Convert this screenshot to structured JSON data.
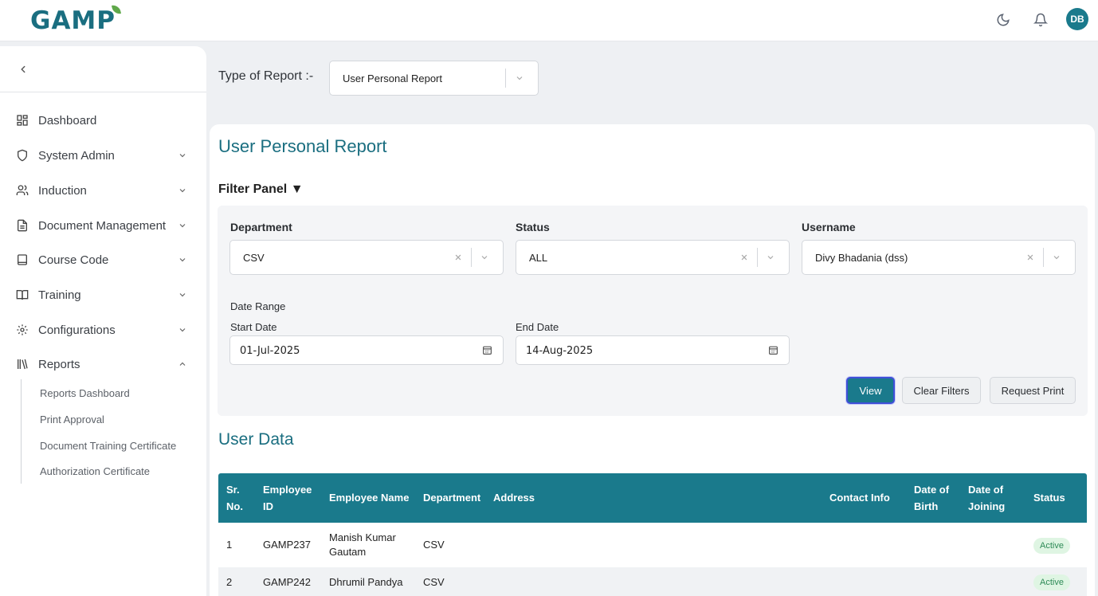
{
  "brand": {
    "logo_text": "GAMP"
  },
  "header": {
    "avatar_initials": "DB",
    "icons": [
      "moon-icon",
      "bell-icon"
    ]
  },
  "sidebar": {
    "items": [
      {
        "label": "Dashboard",
        "icon": "grid-icon",
        "chevron": ""
      },
      {
        "label": "System Admin",
        "icon": "shield-icon",
        "chevron": "down"
      },
      {
        "label": "Induction",
        "icon": "users-icon",
        "chevron": "down"
      },
      {
        "label": "Document Management",
        "icon": "file-icon",
        "chevron": "down"
      },
      {
        "label": "Course Code",
        "icon": "book-icon",
        "chevron": "down"
      },
      {
        "label": "Training",
        "icon": "open-book-icon",
        "chevron": "down"
      },
      {
        "label": "Configurations",
        "icon": "gear-icon",
        "chevron": "down"
      },
      {
        "label": "Reports",
        "icon": "library-icon",
        "chevron": "up"
      }
    ],
    "sub_items": [
      "Reports Dashboard",
      "Print Approval",
      "Document Training Certificate",
      "Authorization Certificate"
    ]
  },
  "report_type": {
    "label": "Type of Report :-",
    "value": "User Personal Report"
  },
  "page": {
    "title": "User Personal Report",
    "filter_title": "Filter Panel ▼"
  },
  "filters": {
    "department": {
      "label": "Department",
      "value": "CSV"
    },
    "status": {
      "label": "Status",
      "value": "ALL"
    },
    "username": {
      "label": "Username",
      "value": "Divy Bhadania (dss)"
    },
    "date_range_label": "Date Range",
    "start_date": {
      "label": "Start Date",
      "value": "01-Jul-2025"
    },
    "end_date": {
      "label": "End Date",
      "value": "14-Aug-2025"
    }
  },
  "buttons": {
    "view": "View",
    "clear": "Clear Filters",
    "print": "Request Print"
  },
  "table": {
    "title": "User Data",
    "headers": {
      "sr_1": "Sr.",
      "sr_2": "No.",
      "emp_id_1": "Employee",
      "emp_id_2": "ID",
      "name": "Employee Name",
      "department": "Department",
      "address": "Address",
      "contact": "Contact Info",
      "dob_1": "Date of",
      "dob_2": "Birth",
      "doj_1": "Date of",
      "doj_2": "Joining",
      "status": "Status"
    },
    "rows": [
      {
        "sr": "1",
        "emp_id": "GAMP237",
        "name_1": "Manish Kumar",
        "name_2": "Gautam",
        "department": "CSV",
        "status": "Active"
      },
      {
        "sr": "2",
        "emp_id": "GAMP242",
        "name_1": "Dhrumil Pandya",
        "name_2": "",
        "department": "CSV",
        "status": "Active"
      }
    ],
    "alt_row_color": "#f0f2f4"
  },
  "colors": {
    "primary": "#1a7a8c",
    "title": "#1a6e80",
    "badge_bg": "#dff5e3",
    "badge_text": "#2e8b57"
  }
}
